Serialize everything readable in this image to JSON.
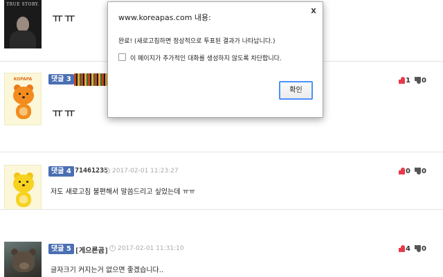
{
  "comments": [
    {
      "avatar_label": "TRUE STORY.",
      "text": "ㅠㅠ"
    },
    {
      "badge": "댓글 3",
      "avatar_label": "KOPAPA",
      "text": "ㅠㅠ",
      "likes": "1",
      "dislikes": "0"
    },
    {
      "badge": "댓글 4",
      "username": "71461235",
      "date": "2017-02-01 11:23:27",
      "text": "저도 새로고침 불편해서 말씀드리고 싶었는데 ㅠㅠ",
      "likes": "0",
      "dislikes": "0"
    },
    {
      "badge": "댓글 5",
      "username": "[게으른곰]",
      "date": "2017-02-01 11:31:10",
      "text": "글자크기 커지는거 없으면 좋겠습니다..",
      "likes": "4",
      "dislikes": "0"
    }
  ],
  "dialog": {
    "title": "www.koreapas.com 내용:",
    "close": "x",
    "message": "완료! (새로고침하면 정상적으로 투표된 결과가 나타납니다.)",
    "checkbox_label": "이 페이지가 추가적인 대화를 생성하지 않도록 차단합니다.",
    "checkbox_checked": false,
    "ok_label": "확인"
  },
  "colors": {
    "badge": "#4a6fb3",
    "like_icon": "#e8394a",
    "dialog_button_border": "#4d90fe"
  },
  "icons": [
    "thumbs-up-icon",
    "thumbs-down-icon",
    "clock-icon",
    "close-icon",
    "checkbox"
  ]
}
